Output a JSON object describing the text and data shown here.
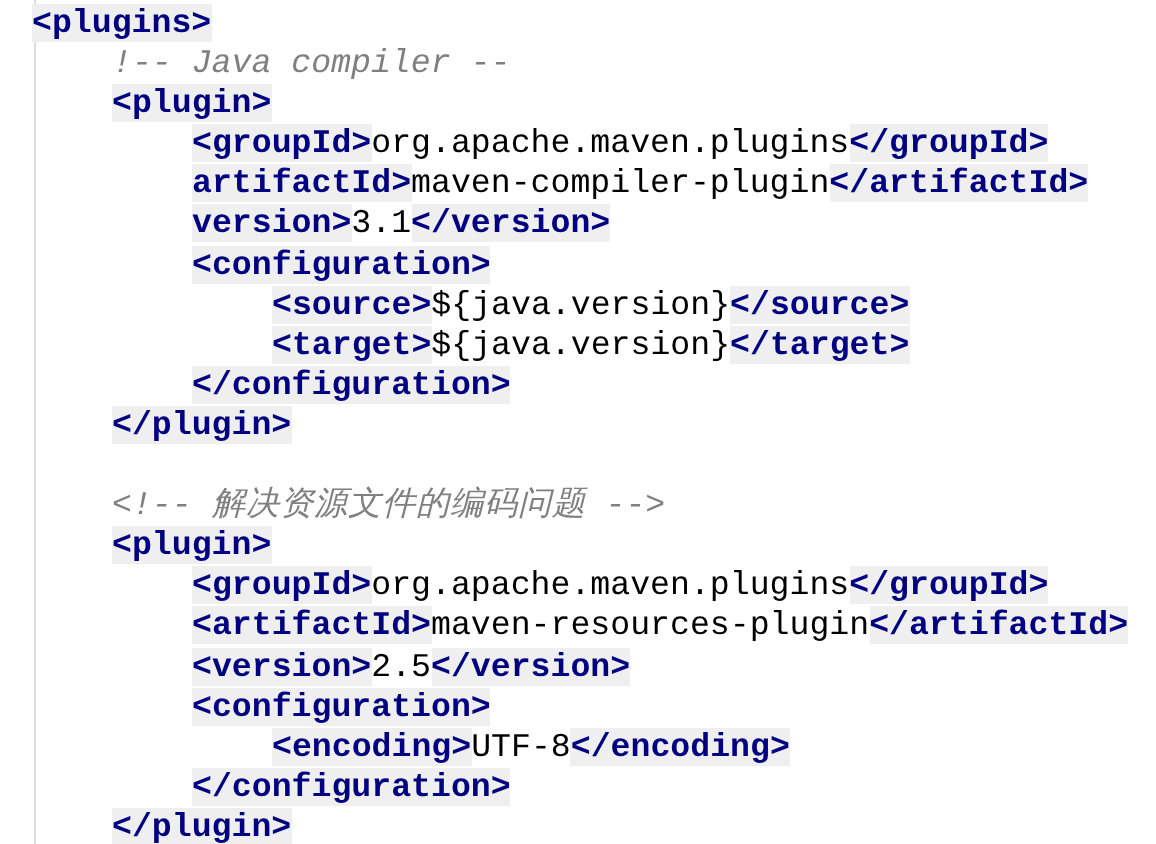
{
  "editor": {
    "lines": [
      {
        "tokens": [
          {
            "kind": "tag",
            "text": "<plugins>"
          }
        ],
        "children": [
          {
            "tokens": [
              {
                "kind": "comment",
                "text": "!-- Java compiler --"
              }
            ]
          },
          {
            "tokens": [
              {
                "kind": "tag",
                "text": "<plugin>"
              }
            ],
            "children": [
              {
                "tokens": [
                  {
                    "kind": "tag",
                    "text": "<groupId>"
                  },
                  {
                    "kind": "text",
                    "text": "org.apache.maven.plugins"
                  },
                  {
                    "kind": "tag",
                    "text": "</groupId>"
                  }
                ]
              },
              {
                "tokens": [
                  {
                    "kind": "tag",
                    "text": "artifactId>"
                  },
                  {
                    "kind": "text",
                    "text": "maven-compiler-plugin"
                  },
                  {
                    "kind": "tag",
                    "text": "</artifactId>"
                  }
                ]
              },
              {
                "tokens": [
                  {
                    "kind": "tag",
                    "text": "version>"
                  },
                  {
                    "kind": "text",
                    "text": "3.1"
                  },
                  {
                    "kind": "tag",
                    "text": "</version>"
                  }
                ]
              },
              {
                "tokens": [
                  {
                    "kind": "tag",
                    "text": "<configuration>"
                  }
                ],
                "children": [
                  {
                    "tokens": [
                      {
                        "kind": "tag",
                        "text": "<source>"
                      },
                      {
                        "kind": "text",
                        "text": "${java.version}"
                      },
                      {
                        "kind": "tag",
                        "text": "</source>"
                      }
                    ]
                  },
                  {
                    "tokens": [
                      {
                        "kind": "tag",
                        "text": "<target>"
                      },
                      {
                        "kind": "text",
                        "text": "${java.version}"
                      },
                      {
                        "kind": "tag",
                        "text": "</target>"
                      }
                    ]
                  }
                ]
              },
              {
                "tokens": [
                  {
                    "kind": "tag",
                    "text": "</configuration>"
                  }
                ]
              }
            ]
          },
          {
            "tokens": [
              {
                "kind": "tag",
                "text": "</plugin>"
              }
            ]
          },
          {
            "blank_line_before": true,
            "tokens": [
              {
                "kind": "comment",
                "text": "<!-- 解决资源文件的编码问题 -->"
              }
            ]
          },
          {
            "tokens": [
              {
                "kind": "tag",
                "text": "<plugin>"
              }
            ],
            "children": [
              {
                "tokens": [
                  {
                    "kind": "tag",
                    "text": "<groupId>"
                  },
                  {
                    "kind": "text",
                    "text": "org.apache.maven.plugins"
                  },
                  {
                    "kind": "tag",
                    "text": "</groupId>"
                  }
                ]
              },
              {
                "tokens": [
                  {
                    "kind": "tag",
                    "text": "<artifactId>"
                  },
                  {
                    "kind": "text",
                    "text": "maven-resources-plugin"
                  },
                  {
                    "kind": "tag",
                    "text": "</artifactId>"
                  }
                ]
              },
              {
                "tokens": [
                  {
                    "kind": "tag",
                    "text": "<version>"
                  },
                  {
                    "kind": "text",
                    "text": "2.5"
                  },
                  {
                    "kind": "tag",
                    "text": "</version>"
                  }
                ]
              },
              {
                "tokens": [
                  {
                    "kind": "tag",
                    "text": "<configuration>"
                  }
                ],
                "children": [
                  {
                    "tokens": [
                      {
                        "kind": "tag",
                        "text": "<encoding>"
                      },
                      {
                        "kind": "text",
                        "text": "UTF-8"
                      },
                      {
                        "kind": "tag",
                        "text": "</encoding>"
                      }
                    ]
                  }
                ]
              },
              {
                "tokens": [
                  {
                    "kind": "tag",
                    "text": "</configuration>"
                  }
                ]
              }
            ]
          },
          {
            "tokens": [
              {
                "kind": "tag",
                "text": "</plugin>"
              }
            ]
          }
        ]
      }
    ]
  }
}
